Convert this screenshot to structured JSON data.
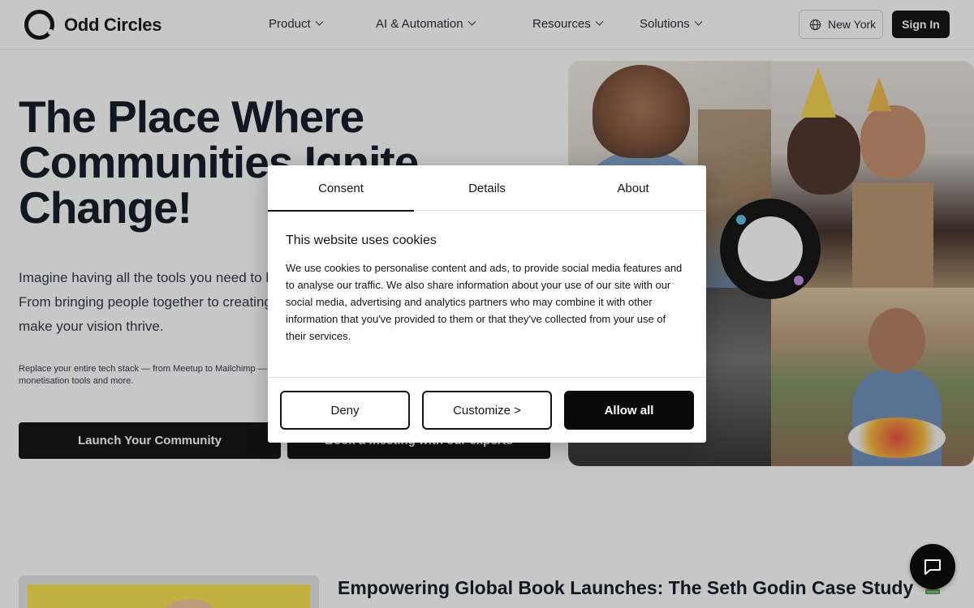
{
  "header": {
    "brand": "Odd Circles",
    "nav": [
      {
        "label": "Product"
      },
      {
        "label": "AI & Automation"
      },
      {
        "label": "Resources"
      },
      {
        "label": "Solutions"
      }
    ],
    "location": "New York",
    "signin": "Sign In"
  },
  "hero": {
    "title": "The Place Where Communities Ignite Change!",
    "description": "Imagine having all the tools you need to build and grow your community effortlessly. From bringing people together to creating meaningful connections, it's all here to make your vision thrive.",
    "small": "Replace your entire tech stack — from Meetup to Mailchimp — with events, email, courses, lead magnets, digital products, monetisation tools and more.",
    "cta_primary": "Launch Your Community",
    "cta_secondary": "Book a meeting with our experts"
  },
  "case_study": {
    "title": "Empowering Global Book Launches: The Seth Godin Case Study"
  },
  "cookie_modal": {
    "tabs": [
      {
        "label": "Consent",
        "active": true
      },
      {
        "label": "Details",
        "active": false
      },
      {
        "label": "About",
        "active": false
      }
    ],
    "heading": "This website uses cookies",
    "body": "We use cookies to personalise content and ads, to provide social media features and to analyse our traffic. We also share information about your use of our site with our social media, advertising and analytics partners who may combine it with other information that you've provided to them or that they've collected from your use of their services.",
    "buttons": {
      "deny": "Deny",
      "customize": "Customize >",
      "allow": "Allow all"
    }
  },
  "colors": {
    "primary": "#0a0a0a",
    "ring_blue": "#59c2e6",
    "ring_purple": "#c58ee6"
  },
  "icons": {
    "globe": "globe-icon",
    "chat": "chat-icon",
    "book": "books-icon",
    "chevron": "chevron-down-icon"
  }
}
